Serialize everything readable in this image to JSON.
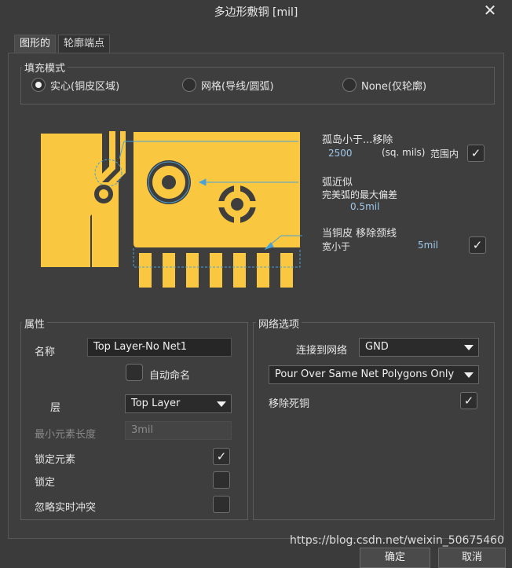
{
  "window": {
    "title": "多边形敷铜 [mil]",
    "close_glyph": "✕"
  },
  "tabs": [
    {
      "label": "图形的"
    },
    {
      "label": "轮廓端点"
    }
  ],
  "fill_mode": {
    "label": "填充模式",
    "options": [
      {
        "label": "实心(铜皮区域)",
        "selected": true
      },
      {
        "label": "网格(导线/圆弧)",
        "selected": false
      },
      {
        "label": "None(仅轮廓)",
        "selected": false
      }
    ]
  },
  "graphic": {
    "copper_color": "#f9c740",
    "island": {
      "label": "孤岛小于...移除",
      "value": "2500",
      "unit": "(sq. mils)",
      "scope_label": "范围内",
      "checked": true
    },
    "arc": {
      "label": "弧近似",
      "sublabel": "完美弧的最大偏差",
      "value": "0.5mil"
    },
    "neck": {
      "label": "当铜皮 移除颈线",
      "sublabel": "宽小于",
      "value": "5mil",
      "checked": true
    }
  },
  "properties": {
    "label": "属性",
    "name_label": "名称",
    "name_value": "Top Layer-No Net1",
    "auto_name_label": "自动命名",
    "auto_name_checked": false,
    "layer_label": "层",
    "layer_value": "Top Layer",
    "min_len_label": "最小元素长度",
    "min_len_value": "3mil",
    "lock_primitives_label": "锁定元素",
    "lock_primitives_checked": true,
    "locked_label": "锁定",
    "locked_checked": false,
    "ignore_online_drc_label": "忽略实时冲突",
    "ignore_online_drc_checked": false
  },
  "net_options": {
    "label": "网络选项",
    "connect_label": "连接到网络",
    "connect_value": "GND",
    "pour_mode_value": "Pour Over Same Net Polygons Only",
    "remove_dead_label": "移除死铜",
    "remove_dead_checked": true
  },
  "watermark": "https://blog.csdn.net/weixin_50675460",
  "buttons": {
    "ok": "确定",
    "cancel": "取消"
  }
}
